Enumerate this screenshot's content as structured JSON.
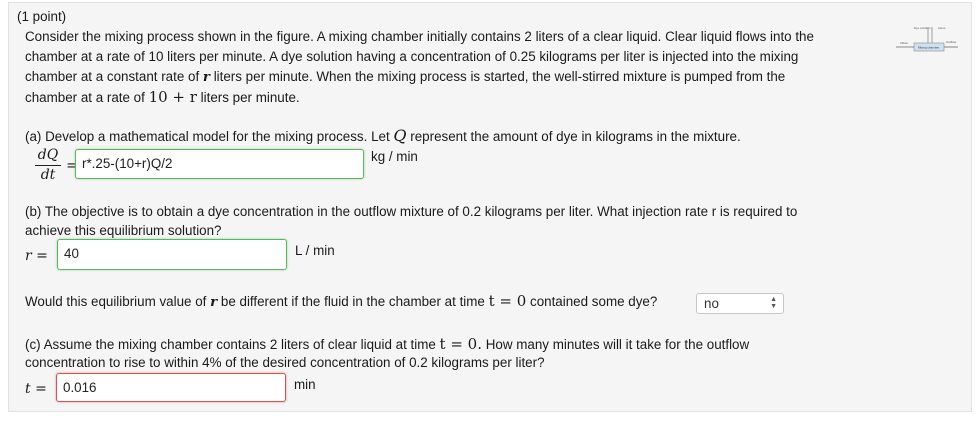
{
  "header": {
    "points": "(1 point)"
  },
  "intro": {
    "line1": "Consider the mixing process shown in the figure. A mixing chamber initially contains 2 liters of a clear liquid. Clear liquid flows into the",
    "line2": "chamber at a rate of 10 liters per minute. A dye solution having a concentration of 0.25 kilograms per liter is injected into the mixing",
    "line3_a": "chamber at a constant rate of ",
    "line3_var": "r",
    "line3_b": " liters per minute. When the mixing process is started, the well-stirred mixture is pumped from the",
    "line4_a": "chamber at a rate of ",
    "line4_math": "10 + r",
    "line4_b": " liters per minute."
  },
  "part_a": {
    "prompt_a": "(a) Develop a mathematical model for the mixing process. Let ",
    "prompt_var": "Q",
    "prompt_b": " represent the amount of dye in kilograms in the mixture.",
    "frac_num": "dQ",
    "frac_den": "dt",
    "equals": "=",
    "answer": "r*.25-(10+r)Q/2",
    "unit": "kg / min"
  },
  "part_b": {
    "line1": "(b) The objective is to obtain a dye concentration in the outflow mixture of 0.2 kilograms per liter. What injection rate r is required to",
    "line2": "achieve this equilibrium solution?",
    "var_label": "r =",
    "answer": "40",
    "unit": "L / min"
  },
  "question_dye": {
    "text_a": "Would this equilibrium value of ",
    "text_var": "r",
    "text_b": " be different if the fluid in the chamber at time ",
    "text_math": "t = 0",
    "text_c": " contained some dye?",
    "selected": "no"
  },
  "part_c": {
    "line1_a": "(c) Assume the mixing chamber contains 2 liters of clear liquid at time ",
    "line1_math": "t = 0.",
    "line1_b": " How many minutes will it take for the outflow",
    "line2": "concentration to rise to within 4% of the desired concentration of 0.2 kilograms per liter?",
    "var_label": "t =",
    "answer": "0.016",
    "unit": "min"
  },
  "figure": {
    "dye_label": "Dye solution",
    "liters_label": "Liters",
    "inflow_label": "Inflow",
    "chamber_label": "Mixing chamber",
    "outflow_label": "Outflow"
  },
  "colors": {
    "correct": "#5cb85c",
    "incorrect": "#d9534f",
    "panel": "#f5f5f5"
  }
}
